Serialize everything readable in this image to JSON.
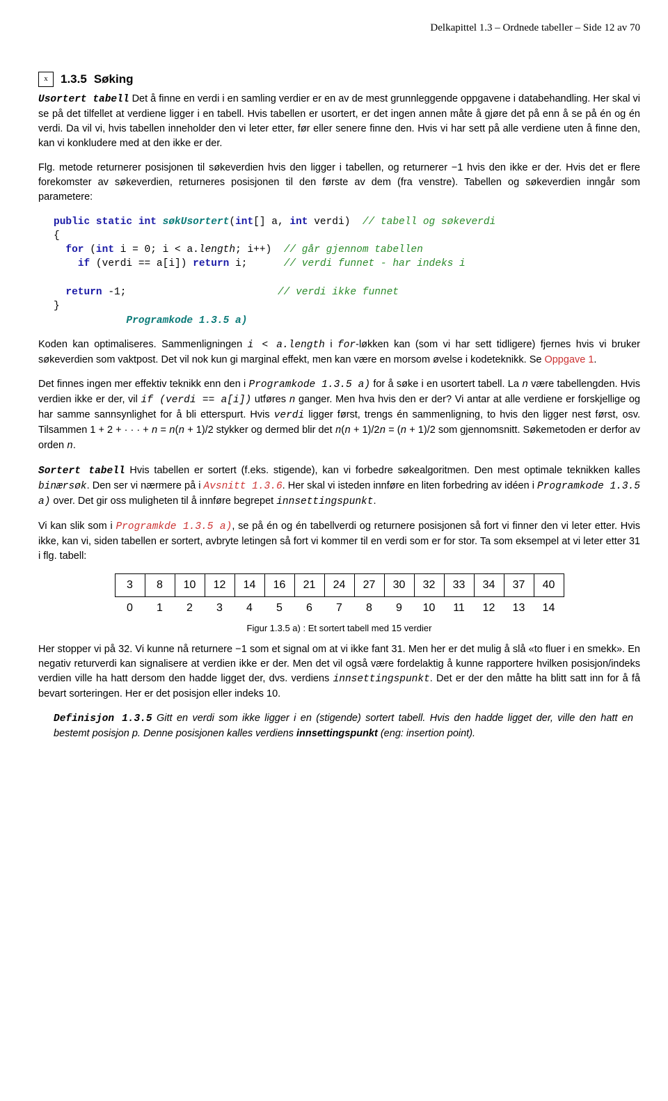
{
  "header": {
    "text": "Delkapittel 1.3 – Ordnede tabeller – Side 12 av 70"
  },
  "heading": {
    "icon": "x",
    "number": "1.3.5",
    "title": "Søking"
  },
  "para1": {
    "runin": "Usortert tabell",
    "text": " Det å finne en verdi i en samling verdier er en av de mest grunnleggende oppgavene i databehandling. Her skal vi se på det tilfellet at verdiene ligger i en tabell. Hvis tabellen er usortert, er det ingen annen måte å gjøre det på enn å se på én og én verdi. Da vil vi, hvis tabellen inneholder den vi leter etter, før eller senere finne den. Hvis vi har sett på alle verdiene uten å finne den, kan vi konkludere med at den ikke er der."
  },
  "para2": {
    "text": "Flg. metode returnerer posisjonen til søkeverdien hvis den ligger i tabellen, og returnerer −1 hvis den ikke er der. Hvis det er flere forekomster av søkeverdien, returneres posisjonen til den første av dem (fra venstre). Tabellen og søkeverdien inngår som parametere:"
  },
  "code1": {
    "line1_kw1": "public static int",
    "line1_fn": "søkUsortert",
    "line1_sig1": "(",
    "line1_kw2": "int",
    "line1_sig2": "[] a, ",
    "line1_kw3": "int",
    "line1_sig3": " verdi)  ",
    "line1_cm": "// tabell og søkeverdi",
    "line2": "{",
    "line3_kw": "for",
    "line3_sig1": " (",
    "line3_kw2": "int",
    "line3_sig2": " i = 0; i < a.",
    "line3_len": "length",
    "line3_sig3": "; i++)  ",
    "line3_cm": "// går gjennom tabellen",
    "line4_kw": "if",
    "line4_sig1": " (verdi == a[i]) ",
    "line4_kw2": "return",
    "line4_sig2": " i;      ",
    "line4_cm": "// verdi funnet - har indeks i",
    "line5_kw": "return",
    "line5_sig": " -1;                         ",
    "line5_cm": "// verdi ikke funnet",
    "line6": "}",
    "caption": "Programkode 1.3.5 a)"
  },
  "para3": {
    "t1": "Koden kan optimaliseres. Sammenligningen ",
    "m1": "i < a.length",
    "t2": " i ",
    "m2": "for",
    "t3": "-løkken kan (som vi har sett tidligere) fjernes hvis vi bruker søkeverdien som vaktpost. Det vil nok kun gi marginal effekt, men kan være en morsom øvelse i kodeteknikk. Se ",
    "link": "Oppgave 1",
    "t4": "."
  },
  "para4": {
    "t1": "Det finnes ingen mer effektiv teknikk enn den i ",
    "m1": "Programkode 1.3.5 a)",
    "t2": " for å søke i en usortert tabell. La ",
    "m2": "n",
    "t3": " være tabellengden. Hvis verdien ikke er der, vil ",
    "m3": "if (verdi == a[i])",
    "t4": " utføres ",
    "m4": "n",
    "t5": " ganger. Men hva hvis den er der? Vi antar at alle verdiene er forskjellige og har samme sannsynlighet for å bli etterspurt. Hvis ",
    "m5": "verdi",
    "t6": " ligger først, trengs én sammenligning, to hvis den ligger nest først, osv. Tilsammen 1 + 2 + · · · + ",
    "m6": "n",
    "t7": " = ",
    "m7": "n",
    "t8": "(",
    "m8": "n",
    "t9": " + 1)/2 stykker og dermed blir det ",
    "m9": "n",
    "t10": "(",
    "m10": "n",
    "t11": " + 1)/2",
    "m11": "n",
    "t12": " = (",
    "m12": "n",
    "t13": " + 1)/2 som gjennomsnitt. Søkemetoden er derfor av orden ",
    "m13": "n",
    "t14": "."
  },
  "para5": {
    "runin": "Sortert tabell",
    "t1": " Hvis tabellen er sortert (f.eks. stigende), kan vi forbedre søkealgoritmen. Den mest optimale teknikken kalles ",
    "m1": "binærsøk",
    "t2": ". Den ser vi nærmere på i ",
    "link": "Avsnitt 1.3.6",
    "t3": ". Her skal vi isteden innføre en liten forbedring av idéen i ",
    "m2": "Programkode 1.3.5 a)",
    "t4": " over. Det gir oss muligheten til å innføre begrepet ",
    "m3": "innsettingspunkt",
    "t5": "."
  },
  "para6": {
    "t1": "Vi kan slik som i ",
    "m1": "Programkde 1.3.5 a)",
    "t2": ", se på én og én tabellverdi og returnere posisjonen så fort vi finner den vi leter etter. Hvis ikke, kan vi, siden tabellen er sortert, avbryte letingen så fort vi kommer til en verdi som er for stor. Ta som eksempel at vi leter etter 31 i flg. tabell:"
  },
  "chart_data": {
    "type": "table",
    "values": [
      3,
      8,
      10,
      12,
      14,
      16,
      21,
      24,
      27,
      30,
      32,
      33,
      34,
      37,
      40
    ],
    "indices": [
      0,
      1,
      2,
      3,
      4,
      5,
      6,
      7,
      8,
      9,
      10,
      11,
      12,
      13,
      14
    ],
    "caption": "Figur 1.3.5 a) : Et sortert tabell med 15 verdier"
  },
  "para7": {
    "t1": "Her stopper vi på 32. Vi kunne nå returnere −1 som et signal om at vi ikke fant 31. Men her er det mulig å slå «to fluer i en smekk». En negativ returverdi kan signalisere at verdien ikke er der. Men det vil også være fordelaktig å kunne rapportere hvilken posisjon/indeks verdien ville ha hatt dersom den hadde ligget der, dvs. verdiens ",
    "m1": "innsettingspunkt",
    "t2": ". Det er der den måtte ha blitt satt inn for å få bevart sorteringen. Her er det posisjon eller indeks 10."
  },
  "definition": {
    "title": "Definisjon 1.3.5",
    "t1": " Gitt en verdi som ikke ligger i en (stigende) sortert tabell. Hvis den hadde ligget der, ville den hatt en bestemt posisjon p. Denne posisjonen kalles verdiens ",
    "b1": "innsettingspunkt",
    "t2": " (eng: insertion point)."
  }
}
